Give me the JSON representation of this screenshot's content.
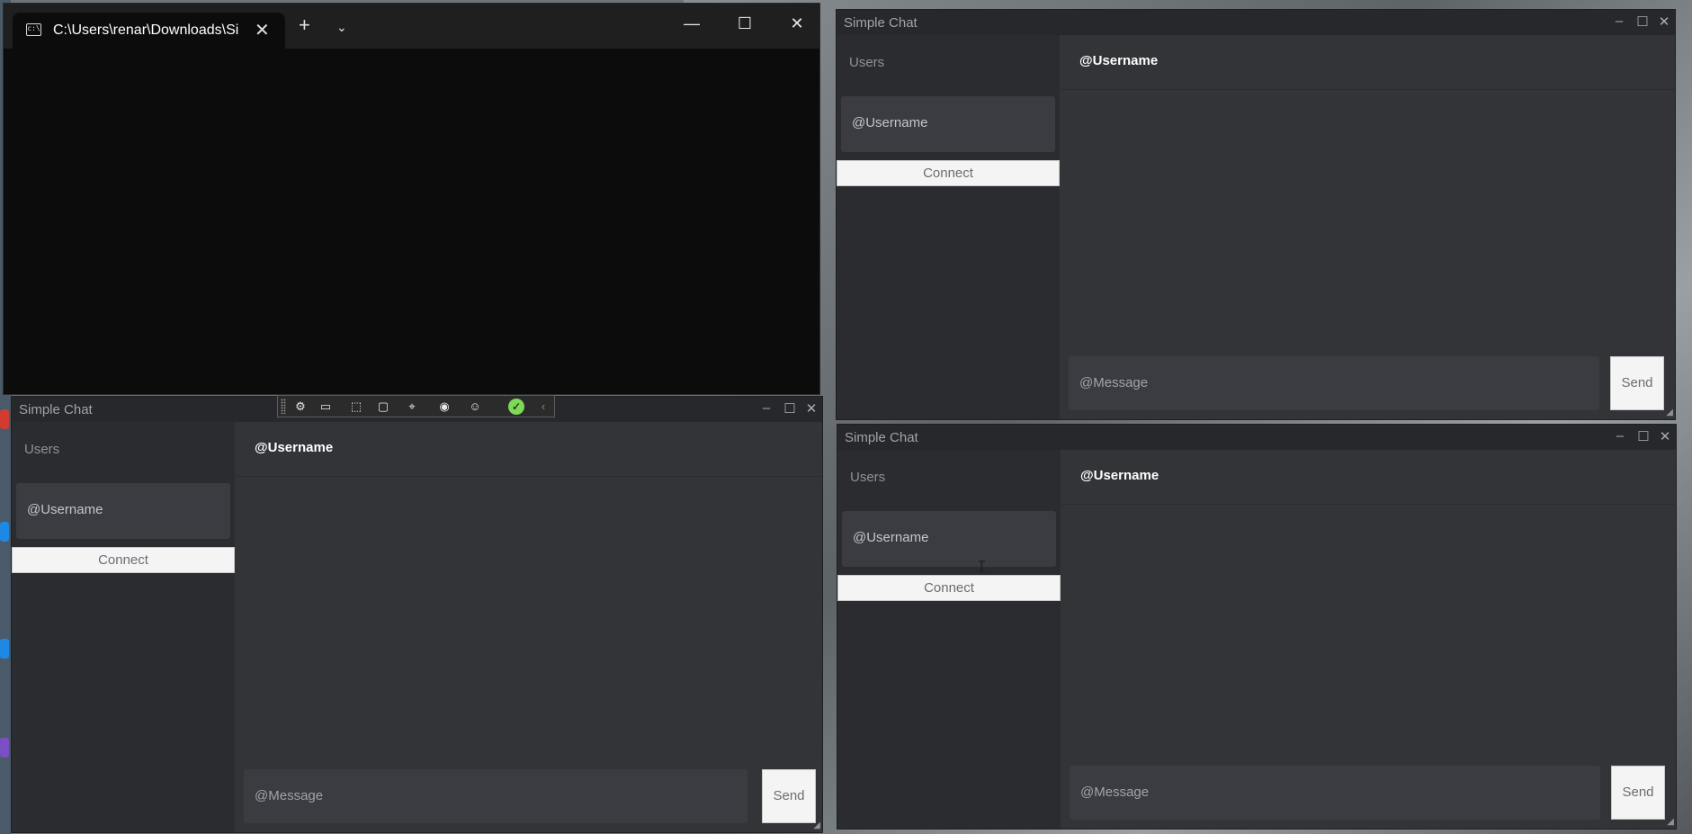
{
  "terminal": {
    "tab_title": "C:\\Users\\renar\\Downloads\\Si",
    "close_symbol": "✕",
    "new_tab_symbol": "+",
    "dropdown_symbol": "⌄",
    "minimize_symbol": "—",
    "maximize_symbol": "☐",
    "window_close_symbol": "✕"
  },
  "chat_windows": [
    {
      "title": "Simple Chat",
      "users_label": "Users",
      "user_card": "@Username",
      "connect_label": "Connect",
      "header_username": "@Username",
      "message_placeholder": "@Message",
      "send_label": "Send"
    },
    {
      "title": "Simple Chat",
      "users_label": "Users",
      "user_card": "@Username",
      "connect_label": "Connect",
      "header_username": "@Username",
      "message_placeholder": "@Message",
      "send_label": "Send"
    },
    {
      "title": "Simple Chat",
      "users_label": "Users",
      "user_card": "@Username",
      "connect_label": "Connect",
      "header_username": "@Username",
      "message_placeholder": "@Message",
      "send_label": "Send"
    }
  ],
  "window_controls": {
    "minimize": "–",
    "maximize": "☐",
    "close": "✕"
  },
  "debug_toolbar": {
    "icons": [
      "live-visual-tree-icon",
      "record-icon",
      "select-element-icon",
      "display-layout-adorners-icon",
      "track-focus-icon",
      "hot-reload-icon",
      "accessibility-icon",
      "binding-ok-icon",
      "collapse-icon"
    ],
    "ok_symbol": "✓",
    "collapse_symbol": "‹"
  },
  "colors": {
    "chat_bg": "#2f3136",
    "sidebar_bg": "#2a2c30",
    "card_bg": "#3a3c41",
    "button_bg": "#f4f4f4",
    "terminal_bg": "#0c0c0c"
  }
}
